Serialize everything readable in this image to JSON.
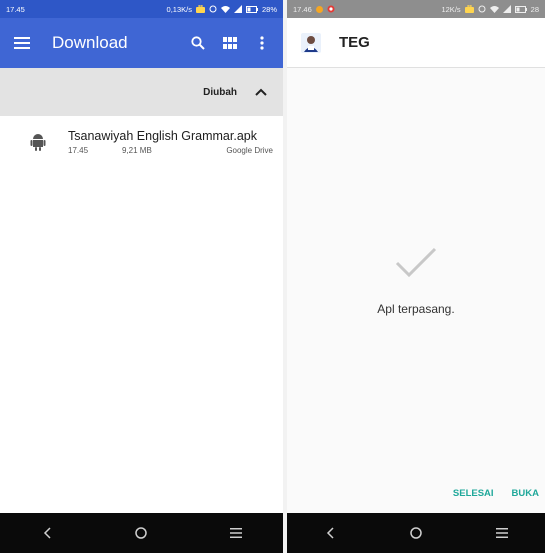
{
  "left": {
    "status": {
      "time": "17.45",
      "net": "0,13K/s",
      "battery": "28%"
    },
    "appbar": {
      "title": "Download",
      "menu_icon": "hamburger-menu-icon",
      "search_icon": "search-icon",
      "grid_icon": "grid-view-icon",
      "more_icon": "more-vert-icon"
    },
    "sort": {
      "label": "Diubah",
      "chevron_icon": "chevron-up-icon"
    },
    "files": [
      {
        "name": "Tsanawiyah English Grammar.apk",
        "time": "17.45",
        "size": "9,21 MB",
        "source": "Google Drive",
        "icon": "android-icon"
      }
    ],
    "nav": {
      "back_icon": "back-icon",
      "home_icon": "home-icon",
      "recents_icon": "recents-icon"
    }
  },
  "right": {
    "status": {
      "time": "17.46",
      "net": "12K/s",
      "battery": "28"
    },
    "appbar": {
      "title": "TEG",
      "logo_icon": "teg-app-logo-icon"
    },
    "message": "Apl terpasang.",
    "actions": {
      "done": "SELESAI",
      "open": "BUKA"
    },
    "check_icon": "checkmark-icon",
    "nav": {
      "back_icon": "back-icon",
      "home_icon": "home-icon",
      "recents_icon": "recents-icon"
    }
  },
  "colors": {
    "appbar_blue": "#3f66d4",
    "status_blue": "#2e57c7",
    "accent_teal": "#1fa89a",
    "nav_black": "#0a0a0a"
  }
}
